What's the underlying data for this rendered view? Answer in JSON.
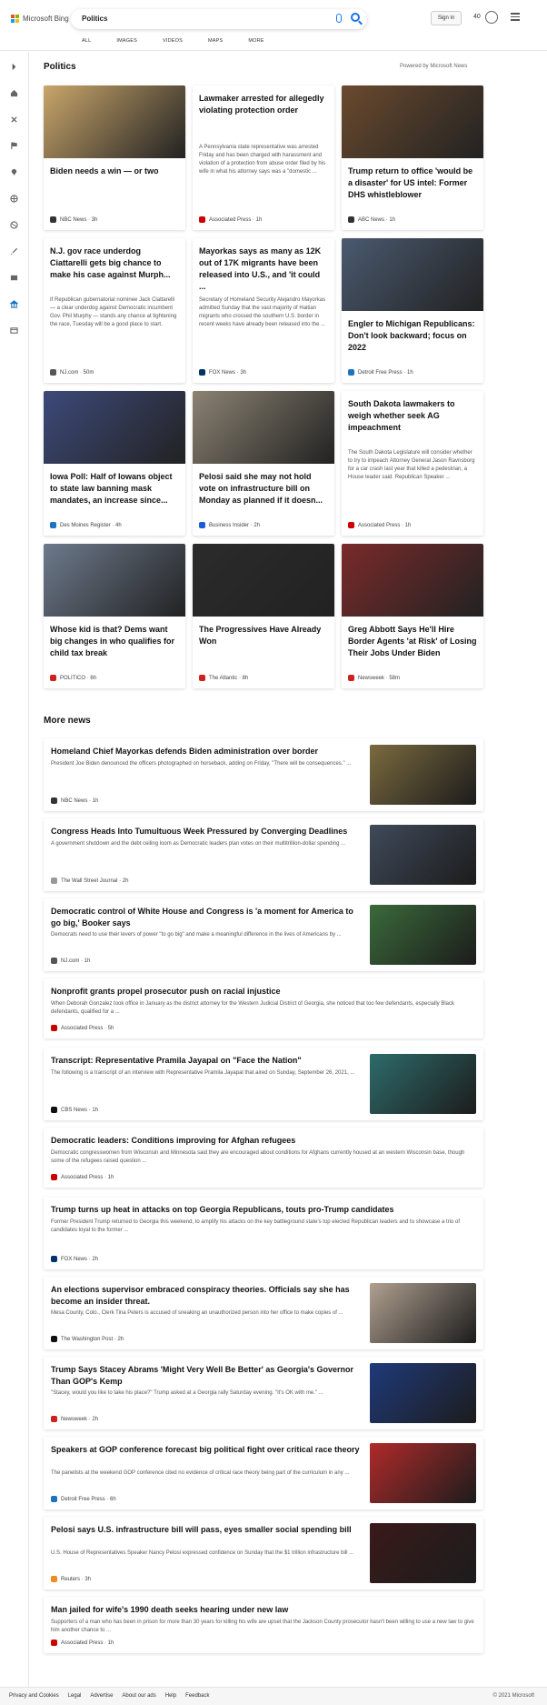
{
  "header": {
    "brand": "Microsoft Bing",
    "logo_colors": [
      "#f25022",
      "#7fba00",
      "#00a4ef",
      "#ffb900"
    ],
    "search_value": "Politics",
    "signin_label": "Sign in",
    "reward_count": "40",
    "tabs": [
      "ALL",
      "IMAGES",
      "VIDEOS",
      "MAPS",
      "MORE"
    ]
  },
  "page": {
    "section_title": "Politics",
    "powered_by": "Powered by Microsoft News",
    "more_news_title": "More news"
  },
  "cards": [
    {
      "title": "Biden needs a win — or two",
      "body": "",
      "source": "NBC News · 3h",
      "source_color": "#333333",
      "img_color": "#c9a66b"
    },
    {
      "title": "Lawmaker arrested for allegedly violating protection order",
      "body": "A Pennsylvania state representative was arrested Friday and has been charged with harassment and violation of a protection from abuse order filed by his wife in what his attorney says was a \"domestic ...",
      "source": "Associated Press · 1h",
      "source_color": "#cc0000",
      "img_color": ""
    },
    {
      "title": "Trump return to office 'would be a disaster' for US intel: Former DHS whistleblower",
      "body": "",
      "source": "ABC News · 1h",
      "source_color": "#333333",
      "img_color": "#6b4a2e"
    },
    {
      "title": "N.J. gov race underdog Ciattarelli gets big chance to make his case against Murph...",
      "body": "If Republican gubernatorial nominee Jack Ciattarelli — a clear underdog against Democratic incumbent Gov. Phil Murphy — stands any chance at tightening the race, Tuesday will be a good place to start.",
      "source": "NJ.com · 50m",
      "source_color": "#555555",
      "img_color": ""
    },
    {
      "title": "Mayorkas says as many as 12K out of 17K migrants have been released into U.S., and 'it could ...",
      "body": "Secretary of Homeland Security Alejandro Mayorkas admitted Sunday that the vast majority of Haitian migrants who crossed the southern U.S. border in recent weeks have already been released into the ...",
      "source": "FOX News · 3h",
      "source_color": "#003366",
      "img_color": ""
    },
    {
      "title": "Engler to Michigan Republicans: Don't look backward; focus on 2022",
      "body": "",
      "source": "Detroit Free Press · 1h",
      "source_color": "#1e73be",
      "img_color": "#4a5a70"
    },
    {
      "title": "Iowa Poll: Half of Iowans object to state law banning mask mandates, an increase since...",
      "body": "",
      "source": "Des Moines Register · 4h",
      "source_color": "#1e73be",
      "img_color": "#3d4a7a"
    },
    {
      "title": "Pelosi said she may not hold vote on infrastructure bill on Monday as planned if it doesn...",
      "body": "",
      "source": "Business Insider · 2h",
      "source_color": "#1e5bd8",
      "img_color": "#8b8272"
    },
    {
      "title": "South Dakota lawmakers to weigh whether seek AG impeachment",
      "body": "The South Dakota Legislature will consider whether to try to impeach Attorney General Jason Ravnsborg for a car crash last year that killed a pedestrian, a House leader said. Republican Speaker ...",
      "source": "Associated Press · 1h",
      "source_color": "#cc0000",
      "img_color": ""
    },
    {
      "title": "Whose kid is that? Dems want big changes in who qualifies for child tax break",
      "body": "",
      "source": "POLITICO · 6h",
      "source_color": "#cc2222",
      "img_color": "#6d7a8c"
    },
    {
      "title": "The Progressives Have Already Won",
      "body": "",
      "source": "The Atlantic · 8h",
      "source_color": "#cc2222",
      "img_color": "#2b2b2b"
    },
    {
      "title": "Greg Abbott Says He'll Hire Border Agents 'at Risk' of Losing Their Jobs Under Biden",
      "body": "",
      "source": "Newsweek · 58m",
      "source_color": "#cc2222",
      "img_color": "#7a2a2a"
    }
  ],
  "more_news": [
    {
      "title": "Homeland Chief Mayorkas defends Biden administration over border",
      "body": "President Joe Biden denounced the officers photographed on horseback, adding on Friday, \"There will be consequences.\" ...",
      "source": "NBC News · 1h",
      "source_color": "#333333",
      "img_color": "#7a6a3e"
    },
    {
      "title": "Congress Heads Into Tumultuous Week Pressured by Converging Deadlines",
      "body": "A government shutdown and the debt ceiling loom as Democratic leaders plan votes on their multitrillion-dollar spending ...",
      "source": "The Wall Street Journal · 2h",
      "source_color": "#999999",
      "img_color": "#3f4a5a"
    },
    {
      "title": "Democratic control of White House and Congress is 'a moment for America to go big,' Booker says",
      "body": "Democrats need to use their levers of power \"to go big\" and make a meaningful difference in the lives of Americans by ...",
      "source": "NJ.com · 1h",
      "source_color": "#555555",
      "img_color": "#3a6a3a"
    },
    {
      "title": "Nonprofit grants propel prosecutor push on racial injustice",
      "body": "When Deborah Gonzalez took office in January as the district attorney for the Western Judicial District of Georgia, she noticed that too few defendants, especially Black defendants, qualified for a ...",
      "source": "Associated Press · 5h",
      "source_color": "#cc0000",
      "img_color": ""
    },
    {
      "title": "Transcript: Representative Pramila Jayapal on \"Face the Nation\"",
      "body": "The following is a transcript of an interview with Representative Pramila Jayapal that aired on Sunday, September 26, 2021, ...",
      "source": "CBS News · 1h",
      "source_color": "#111111",
      "img_color": "#2e6b6b"
    },
    {
      "title": "Democratic leaders: Conditions improving for Afghan refugees",
      "body": "Democratic congresswomen from Wisconsin and Minnesota said they are encouraged about conditions for Afghans currently housed at an western Wisconsin base, though some of the refugees raised question ...",
      "source": "Associated Press · 1h",
      "source_color": "#cc0000",
      "img_color": ""
    },
    {
      "title": "Trump turns up heat in attacks on top Georgia Republicans, touts pro-Trump candidates",
      "body": "Former President Trump returned to Georgia this weekend, to amplify his attacks on the key battleground state's top elected Republican leaders and to showcase a trio of candidates loyal to the former ...",
      "source": "FOX News · 2h",
      "source_color": "#003366",
      "img_color": ""
    },
    {
      "title": "An elections supervisor embraced conspiracy theories. Officials say she has become an insider threat.",
      "body": "Mesa County, Colo., Clerk Tina Peters is accused of sneaking an unauthorized person into her office to make copies of ...",
      "source": "The Washington Post · 2h",
      "source_color": "#111111",
      "img_color": "#b0a090"
    },
    {
      "title": "Trump Says Stacey Abrams 'Might Very Well Be Better' as Georgia's Governor Than GOP's Kemp",
      "body": "\"Stacey, would you like to take his place?\" Trump asked at a Georgia rally Saturday evening. \"It's OK with me.\" ...",
      "source": "Newsweek · 2h",
      "source_color": "#cc2222",
      "img_color": "#1f3a7a"
    },
    {
      "title": "Speakers at GOP conference forecast big political fight over critical race theory",
      "body": "The panelists at the weekend GOP conference cited no evidence of critical race theory being part of the curriculum in any ...",
      "source": "Detroit Free Press · 6h",
      "source_color": "#1e73be",
      "img_color": "#b02a2a"
    },
    {
      "title": "Pelosi says U.S. infrastructure bill will pass, eyes smaller social spending bill",
      "body": "U.S. House of Representatives Speaker Nancy Pelosi expressed confidence on Sunday that the $1 trillion infrastructure bill ...",
      "source": "Reuters · 3h",
      "source_color": "#f08a24",
      "img_color": "#3a1a1a"
    },
    {
      "title": "Man jailed for wife's 1990 death seeks hearing under new law",
      "body": "Supporters of a man who has been in prison for more than 30 years for killing his wife are upset that the Jackson County prosecutor hasn't been willing to use a new law to give him another chance to ...",
      "source": "Associated Press · 1h",
      "source_color": "#cc0000",
      "img_color": ""
    }
  ],
  "footer": {
    "links": [
      "Privacy and Cookies",
      "Legal",
      "Advertise",
      "About our ads",
      "Help",
      "Feedback"
    ],
    "copyright": "© 2021 Microsoft"
  },
  "sidebar_icons": [
    "chevron-right-icon",
    "home-icon",
    "tools-icon",
    "flag-icon",
    "location-icon",
    "globe-icon",
    "sports-icon",
    "rocket-icon",
    "film-icon",
    "bank-icon",
    "card-icon"
  ]
}
